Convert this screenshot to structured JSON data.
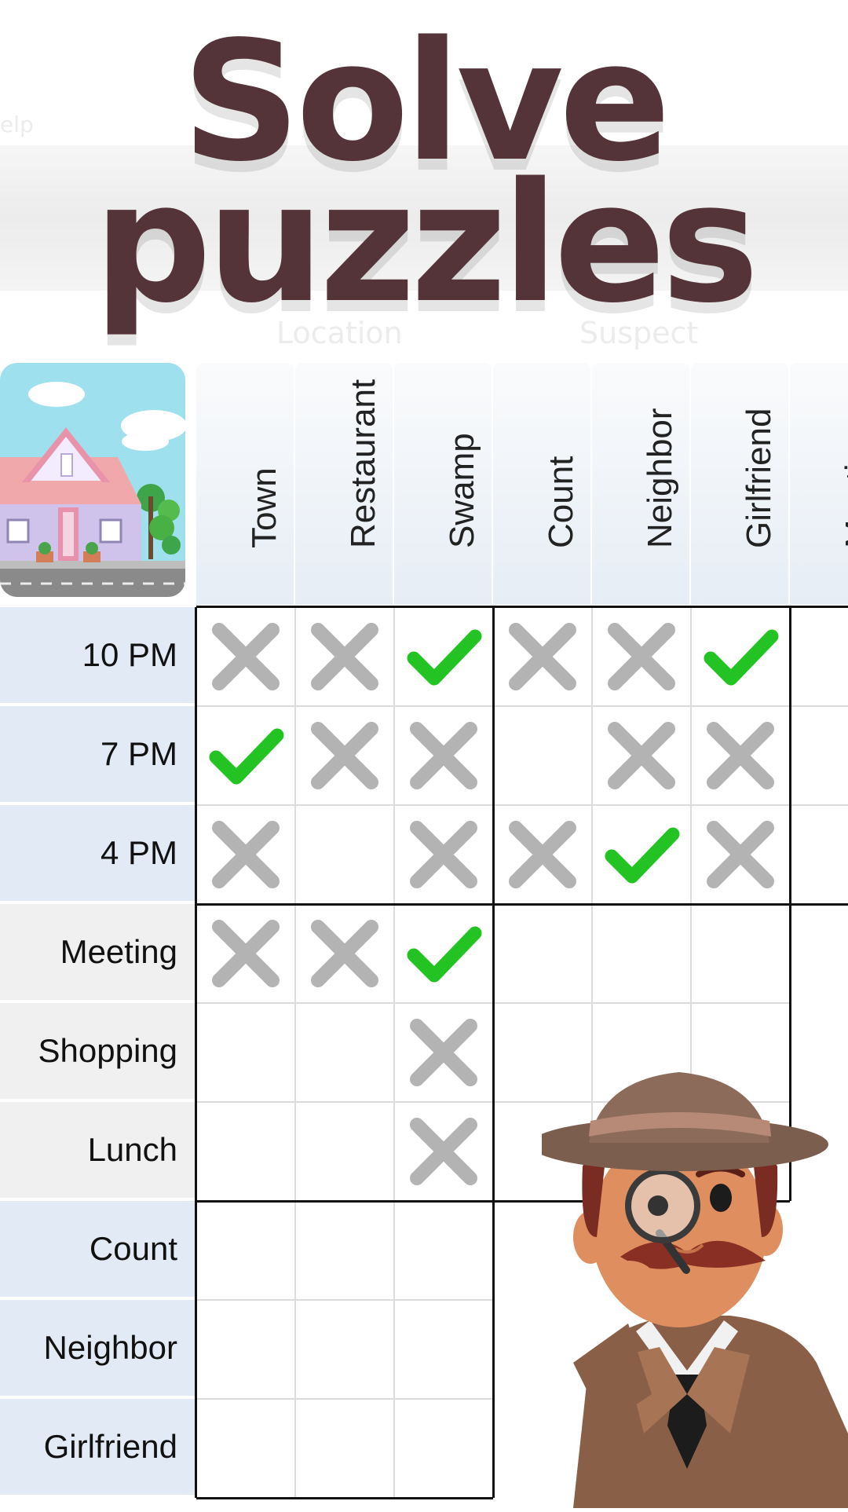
{
  "title": {
    "line1": "Solve",
    "line2": "puzzles"
  },
  "faint_labels": {
    "group1": "Location",
    "group2": "Suspect",
    "left": "elp"
  },
  "columns": [
    "Town",
    "Restaurant",
    "Swamp",
    "Count",
    "Neighbor",
    "Girlfriend",
    "Meeting"
  ],
  "rows": [
    "10 PM",
    "7 PM",
    "4 PM",
    "Meeting",
    "Shopping",
    "Lunch",
    "Count",
    "Neighbor",
    "Girlfriend"
  ],
  "grid": [
    [
      "x",
      "x",
      "check",
      "x",
      "x",
      "check",
      ""
    ],
    [
      "check",
      "x",
      "x",
      "",
      "x",
      "x",
      ""
    ],
    [
      "x",
      "",
      "x",
      "x",
      "check",
      "x",
      ""
    ],
    [
      "x",
      "x",
      "check",
      "",
      "",
      "",
      ""
    ],
    [
      "",
      "",
      "x",
      "",
      "",
      "",
      ""
    ],
    [
      "",
      "",
      "x",
      "",
      "",
      "",
      ""
    ],
    [
      "",
      "",
      "",
      "",
      "",
      "",
      ""
    ],
    [
      "",
      "",
      "",
      "",
      "",
      "",
      ""
    ],
    [
      "",
      "",
      "",
      "",
      "",
      "",
      ""
    ]
  ],
  "colors": {
    "title": "#543438",
    "check": "#22c322",
    "cross": "#b3b3b3",
    "row_blue": "#e2ebf5",
    "row_gray": "#f0f0f0"
  },
  "icons": {
    "house": "house-illustration",
    "detective": "detective-with-magnifier"
  }
}
